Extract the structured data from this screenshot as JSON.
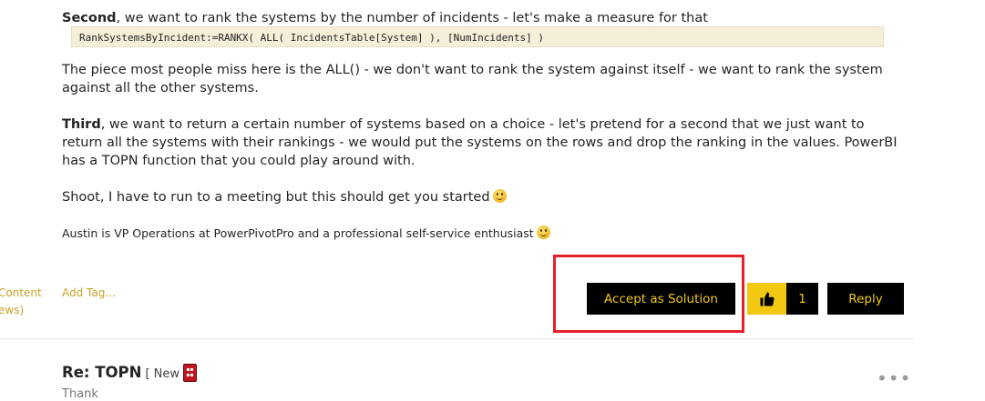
{
  "post": {
    "p1_bold": "Second",
    "p1_rest": ", we want to rank the systems by the number of incidents - let's make a measure for that",
    "code": "RankSystemsByIncident:=RANKX( ALL( IncidentsTable[System] ), [NumIncidents] )",
    "p2": "The piece most people miss here is the ALL() - we don't want to rank the system against itself - we want to rank the system against all the other systems.",
    "p3_bold": "Third",
    "p3_rest": ", we want to return a certain number of systems based on a choice - let's pretend for a second that we just want to return all the systems with their rankings - we would put the systems on the rows and drop the ranking in the values. PowerBI has a TOPN function that you could play around with.",
    "p4": "Shoot, I have to run to a meeting but this should get you started",
    "signature": "Austin is VP Operations at PowerPivotPro and a professional self-service enthusiast"
  },
  "left_cut": {
    "line1": "Content",
    "line2": "ews)"
  },
  "actions": {
    "add_tag": "Add Tag...",
    "accept_label": "Accept as Solution",
    "kudos_count": "1",
    "reply_label": "Reply"
  },
  "next_post": {
    "title": "Re: TOPN",
    "new_tag": "[ New ]",
    "more": "•••",
    "preview": "Thank"
  },
  "colors": {
    "accent": "#f2c811",
    "button_bg": "#000000",
    "highlight": "#e6202a"
  },
  "icons": {
    "smiley": "smiley-icon",
    "thumbs_up": "thumbs-up-icon",
    "rank_badge": "rank-badge-icon",
    "more": "more-options-icon"
  }
}
